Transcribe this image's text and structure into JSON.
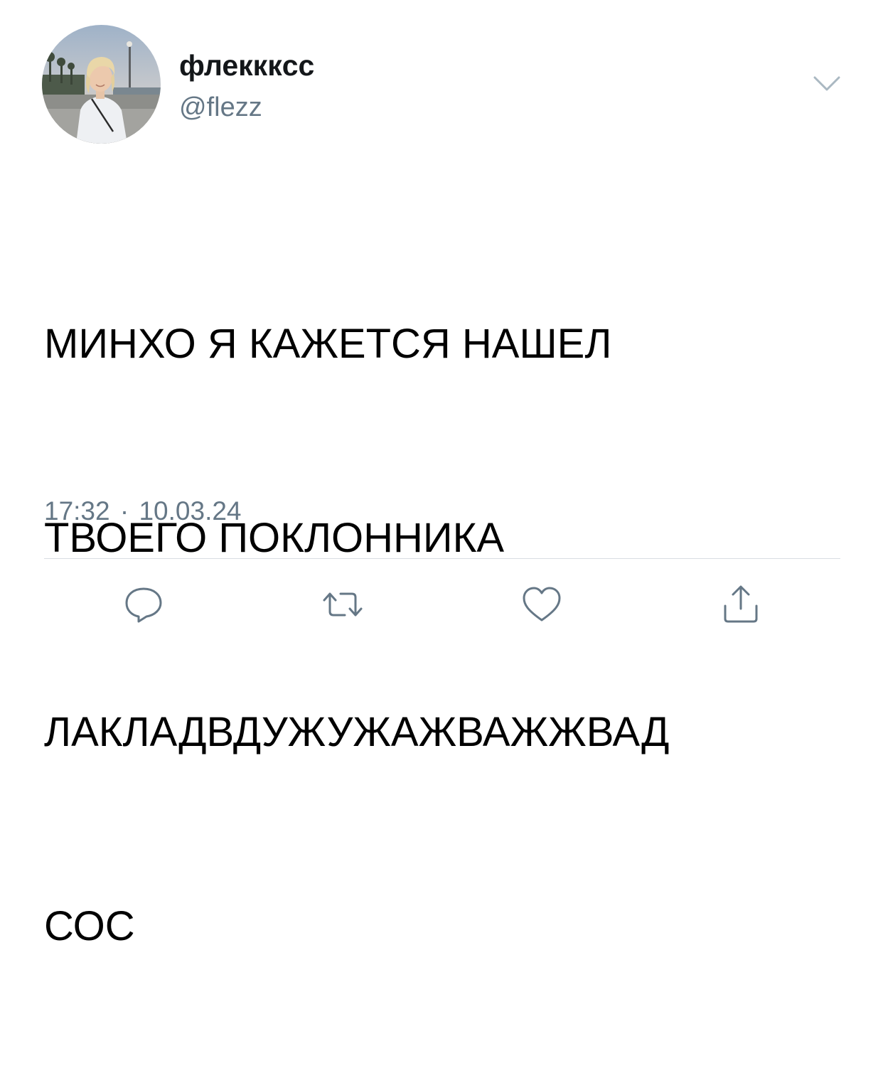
{
  "user": {
    "display_name": "флекккcc",
    "handle": "@flezz"
  },
  "tweet": {
    "lines": [
      "МИНХО Я КАЖЕТСЯ НАШЕЛ",
      "ТВОЕГО ПОКЛОННИКА",
      "ЛАКЛАДВДУЖУЖАЖВАЖЖВАД",
      "СОС"
    ],
    "time": "17:32",
    "separator": "·",
    "date": "10.03.24"
  },
  "actions": {
    "reply_icon": "reply-icon",
    "retweet_icon": "retweet-icon",
    "like_icon": "heart-icon",
    "share_icon": "share-icon"
  },
  "colors": {
    "text": "#000000",
    "secondary": "#657786",
    "icon": "#657786",
    "divider": "#d8dde2"
  }
}
